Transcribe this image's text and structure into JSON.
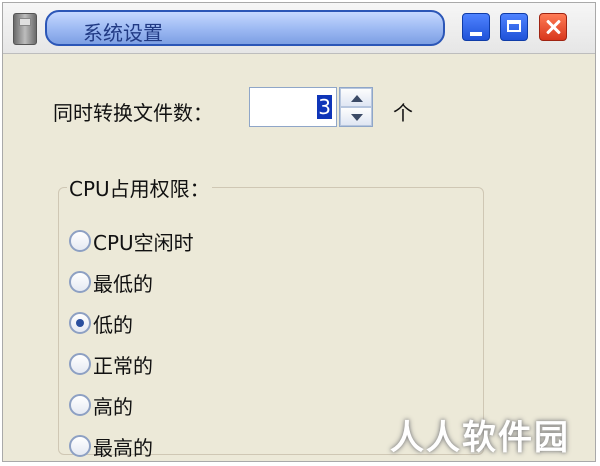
{
  "window": {
    "title": "系统设置"
  },
  "settings": {
    "label": "同时转换文件数：",
    "value": "3",
    "unit": "个"
  },
  "cpu_group": {
    "legend": "CPU占用权限：",
    "options": [
      {
        "label": "CPU空闲时",
        "checked": false
      },
      {
        "label": "最低的",
        "checked": false
      },
      {
        "label": "低的",
        "checked": true
      },
      {
        "label": "正常的",
        "checked": false
      },
      {
        "label": "高的",
        "checked": false
      },
      {
        "label": "最高的",
        "checked": false
      }
    ]
  },
  "watermark": "人人软件园",
  "colors": {
    "title_pill": "#9bb8f2",
    "close_button": "#d8371c",
    "window_bg": "#ece9d8"
  }
}
